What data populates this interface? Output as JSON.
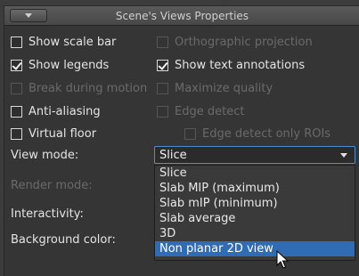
{
  "panel": {
    "title": "Scene's Views Properties"
  },
  "options": {
    "show_scale_bar": {
      "label": "Show scale bar",
      "checked": false,
      "enabled": true
    },
    "orthographic_projection": {
      "label": "Orthographic projection",
      "checked": false,
      "enabled": false
    },
    "show_legends": {
      "label": "Show legends",
      "checked": true,
      "enabled": true
    },
    "show_text_annotations": {
      "label": "Show text annotations",
      "checked": true,
      "enabled": true
    },
    "break_during_motion": {
      "label": "Break during motion",
      "checked": false,
      "enabled": false
    },
    "maximize_quality": {
      "label": "Maximize quality",
      "checked": false,
      "enabled": false
    },
    "anti_aliasing": {
      "label": "Anti-aliasing",
      "checked": false,
      "enabled": true
    },
    "edge_detect": {
      "label": "Edge detect",
      "checked": false,
      "enabled": false
    },
    "virtual_floor": {
      "label": "Virtual floor",
      "checked": false,
      "enabled": true
    },
    "edge_detect_only_rois": {
      "label": "Edge detect only ROIs",
      "checked": false,
      "enabled": false
    }
  },
  "fields": {
    "view_mode_label": "View mode:",
    "render_mode_label": "Render mode:",
    "interactivity_label": "Interactivity:",
    "background_color_label": "Background color:"
  },
  "view_mode": {
    "selected": "Slice",
    "options": [
      "Slice",
      "Slab MIP (maximum)",
      "Slab mIP (minimum)",
      "Slab average",
      "3D",
      "Non planar 2D view"
    ],
    "hovered": "Non planar 2D view"
  },
  "colors": {
    "highlight": "#2f6cb3",
    "focus_border": "#4a8fd1"
  }
}
